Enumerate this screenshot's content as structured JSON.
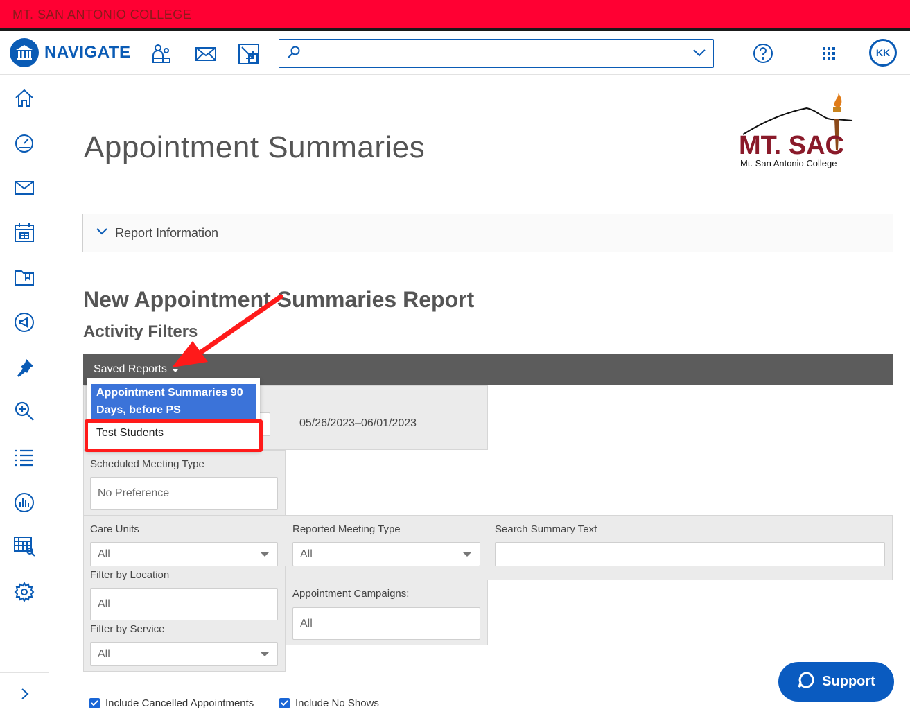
{
  "topbar": {
    "college": "MT. SAN ANTONIO COLLEGE"
  },
  "nav": {
    "brand": "NAVIGATE",
    "icons": [
      "students-icon",
      "message-icon",
      "quick-links-icon"
    ],
    "search": {
      "placeholder": ""
    },
    "avatar": "KK"
  },
  "sidebar": {
    "items": [
      "home-icon",
      "dashboard-icon",
      "message-icon",
      "calendar-icon",
      "folder-icon",
      "campaigns-icon",
      "pin-icon",
      "search-icon",
      "list-icon",
      "reports-icon",
      "analytics-icon",
      "settings-icon"
    ]
  },
  "page": {
    "title": "Appointment Summaries",
    "logo_name": "MT. SAC",
    "logo_sub": "Mt. San Antonio College"
  },
  "report_info": {
    "label": "Report Information"
  },
  "report": {
    "heading": "New Appointment Summaries Report",
    "filters_heading": "Activity Filters",
    "saved_reports": "Saved Reports",
    "dropdown": {
      "selected": "Appointment Summaries 90 Days, before PS",
      "item": "Test Students"
    },
    "date_range": "05/26/2023–06/01/2023",
    "scheduled_meeting_type": {
      "label": "Scheduled Meeting Type",
      "value": "No Preference"
    },
    "care_units": {
      "label": "Care Units",
      "value": "All"
    },
    "reported_meeting_type": {
      "label": "Reported Meeting Type",
      "value": "All"
    },
    "search_summary": {
      "label": "Search Summary Text",
      "value": ""
    },
    "filter_location": {
      "label": "Filter by Location",
      "value": "All"
    },
    "appointment_campaigns": {
      "label": "Appointment Campaigns:",
      "value": "All"
    },
    "filter_service": {
      "label": "Filter by Service",
      "value": "All"
    },
    "include_cancelled": "Include Cancelled Appointments",
    "include_no_shows": "Include No Shows"
  },
  "support": {
    "label": "Support"
  },
  "colors": {
    "brand_blue": "#0a5bb5",
    "top_red": "#ff0033",
    "highlight_red": "#ff1a1a",
    "selected_blue": "#3b73d9"
  }
}
